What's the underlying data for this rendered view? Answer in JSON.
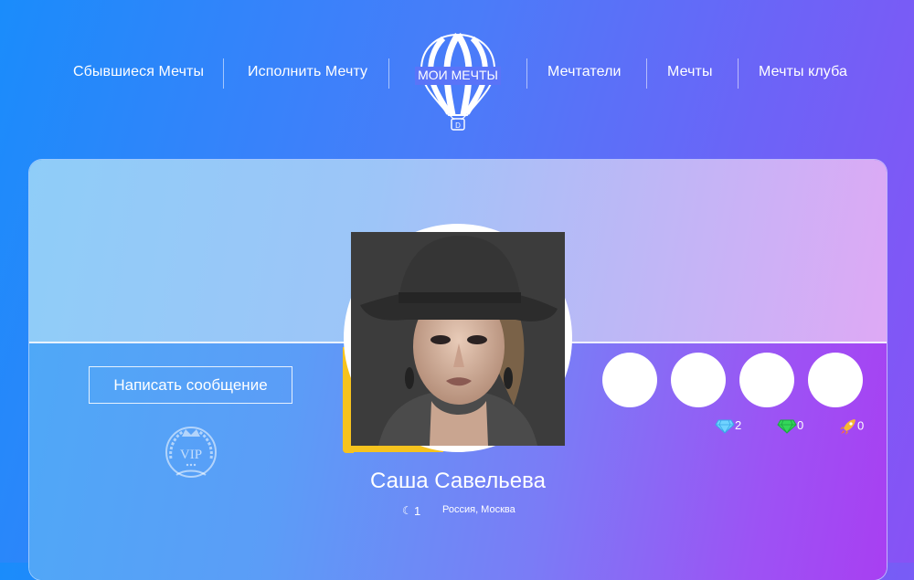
{
  "nav": {
    "left": [
      {
        "label": "Сбывшиеся Мечты"
      },
      {
        "label": "Исполнить Мечту"
      }
    ],
    "logo_text": "МОИ МЕЧТЫ",
    "logo_icon": "hot-air-balloon-icon",
    "right": [
      {
        "label": "Мечтатели"
      },
      {
        "label": "Мечты"
      },
      {
        "label": "Мечты клуба"
      }
    ]
  },
  "profile": {
    "message_button": "Написать сообщение",
    "vip_badge": "VIP",
    "name": "Саша Савельева",
    "count": "1",
    "location": "Россия, Москва",
    "accent_color": "#f6c31e"
  },
  "stats": [
    {
      "icon": "blue-diamond-icon",
      "value": "2",
      "color": "#6fd3ff"
    },
    {
      "icon": "green-diamond-icon",
      "value": "0",
      "color": "#34d65a"
    },
    {
      "icon": "rocket-icon",
      "value": "0",
      "color": "#f7b733"
    }
  ]
}
